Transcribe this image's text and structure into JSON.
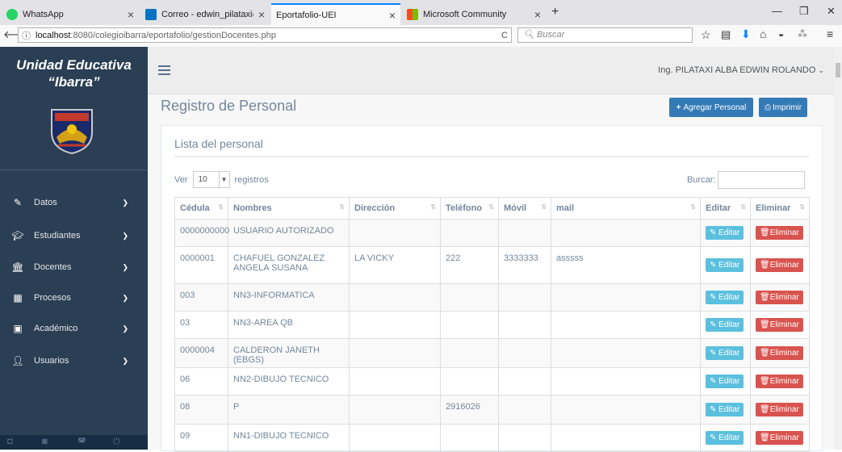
{
  "browser": {
    "tabs": [
      {
        "title": "WhatsApp",
        "icon": "whatsapp-icon",
        "color": "#25d366"
      },
      {
        "title": "Correo - edwin_pilataxi@hot",
        "icon": "outlook-icon",
        "color": "#0072c6"
      },
      {
        "title": "Eportafolio-UEI",
        "icon": "page-icon",
        "color": "#f9f9fa"
      },
      {
        "title": "Microsoft Community",
        "icon": "microsoft-icon",
        "color": "#f25022"
      }
    ],
    "url_host": "localhost",
    "url_path": ":8080/colegioibarra/eportafolio/gestionDocentes.php",
    "search_placeholder": "Buscar"
  },
  "sidebar": {
    "brand_line1": "Unidad Educativa",
    "brand_line2": "“Ibarra”",
    "items": [
      {
        "label": "Datos",
        "icon": "edit-icon"
      },
      {
        "label": "Estudiantes",
        "icon": "graduation-cap-icon"
      },
      {
        "label": "Docentes",
        "icon": "institution-icon"
      },
      {
        "label": "Procesos",
        "icon": "table-icon"
      },
      {
        "label": "Académico",
        "icon": "calendar-icon"
      },
      {
        "label": "Usuarios",
        "icon": "user-icon"
      }
    ]
  },
  "header": {
    "user": "Ing. PILATAXI ALBA EDWIN ROLANDO"
  },
  "page": {
    "title": "Registro de Personal",
    "add_button": "Agregar Personal",
    "print_button": "Imprimir",
    "panel_title": "Lista del personal",
    "show_label": "Ver",
    "show_value": "10",
    "records_label": "registros",
    "search_label": "Burcar:"
  },
  "table": {
    "headers": [
      "Cédula",
      "Nombres",
      "Dirección",
      "Teléfono",
      "Móvil",
      "mail",
      "Editar",
      "Eliminar"
    ],
    "edit_label": "Editar",
    "delete_label": "Eliminar",
    "rows": [
      [
        "0000000000",
        "USUARIO AUTORIZADO",
        "",
        "",
        "",
        ""
      ],
      [
        "0000001",
        "CHAFUEL GONZALEZ ANGELA SUSANA",
        "LA VICKY",
        "222",
        "3333333",
        "asssss"
      ],
      [
        "003",
        "NN3-INFORMATICA",
        "",
        "",
        "",
        ""
      ],
      [
        "03",
        "NN3-AREA QB",
        "",
        "",
        "",
        ""
      ],
      [
        "0000004",
        "CALDERON JANETH (EBGS)",
        "",
        "",
        "",
        ""
      ],
      [
        "06",
        "NN2-DIBUJO TECNICO",
        "",
        "",
        "",
        ""
      ],
      [
        "08",
        "P",
        "",
        "2916026",
        "",
        ""
      ],
      [
        "09",
        "NN1-DIBUJO TECNICO",
        "",
        "",
        "",
        ""
      ]
    ]
  }
}
